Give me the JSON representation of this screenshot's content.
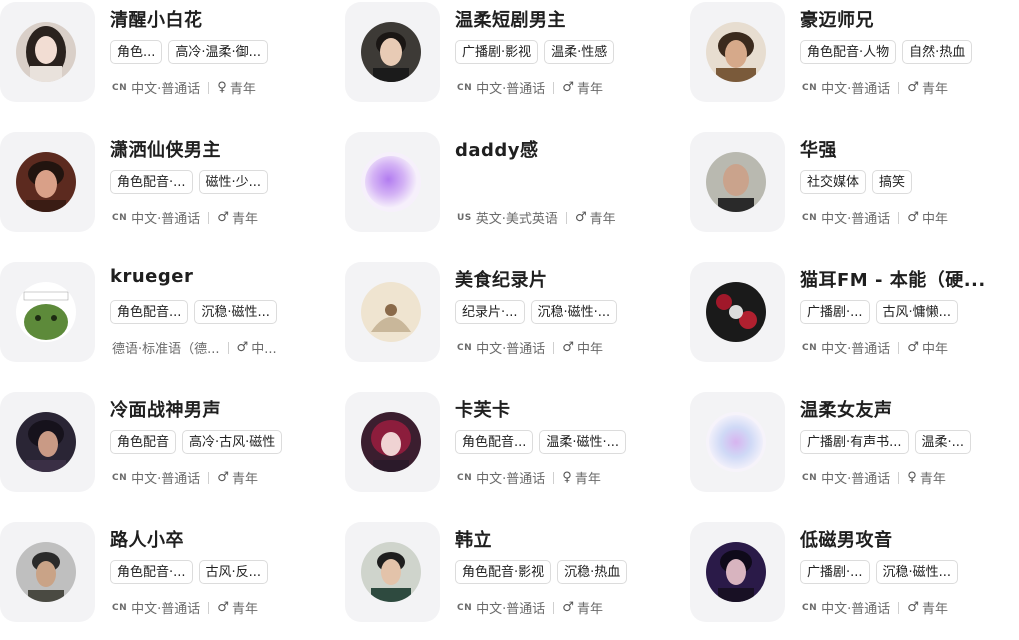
{
  "voices": [
    {
      "name": "清醒小白花",
      "tags": [
        "角色...",
        "高冷·温柔·御..."
      ],
      "country_code": "CN",
      "language": "中文·普通话",
      "gender_icon": "female-icon",
      "gender_symbol": "♀",
      "age": "青年",
      "avatar": "female-portrait"
    },
    {
      "name": "温柔短剧男主",
      "tags": [
        "广播剧·影视",
        "温柔·性感"
      ],
      "country_code": "CN",
      "language": "中文·普通话",
      "gender_icon": "male-icon",
      "gender_symbol": "♂",
      "age": "青年",
      "avatar": "male-portrait"
    },
    {
      "name": "豪迈师兄",
      "tags": [
        "角色配音·人物",
        "自然·热血"
      ],
      "country_code": "CN",
      "language": "中文·普通话",
      "gender_icon": "male-icon",
      "gender_symbol": "♂",
      "age": "青年",
      "avatar": "warrior-portrait"
    },
    {
      "name": "潇洒仙侠男主",
      "tags": [
        "角色配音·...",
        "磁性·少..."
      ],
      "country_code": "CN",
      "language": "中文·普通话",
      "gender_icon": "male-icon",
      "gender_symbol": "♂",
      "age": "青年",
      "avatar": "xianxia-portrait"
    },
    {
      "name": "daddy感",
      "tags": [],
      "country_code": "US",
      "language": "英文·美式英语",
      "gender_icon": "male-icon",
      "gender_symbol": "♂",
      "age": "青年",
      "avatar": "purple-blob"
    },
    {
      "name": "华强",
      "tags": [
        "社交媒体",
        "搞笑"
      ],
      "country_code": "CN",
      "language": "中文·普通话",
      "gender_icon": "male-icon",
      "gender_symbol": "♂",
      "age": "中年",
      "avatar": "man-photo"
    },
    {
      "name": "krueger",
      "tags": [
        "角色配音...",
        "沉稳·磁性..."
      ],
      "country_code": "",
      "language": "德语·标准语（德...",
      "gender_icon": "male-icon",
      "gender_symbol": "♂",
      "age": "中...",
      "avatar": "cartoon-frog"
    },
    {
      "name": "美食纪录片",
      "tags": [
        "纪录片·...",
        "沉稳·磁性·..."
      ],
      "country_code": "CN",
      "language": "中文·普通话",
      "gender_icon": "male-icon",
      "gender_symbol": "♂",
      "age": "中年",
      "avatar": "ink-painting"
    },
    {
      "name": "猫耳FM - 本能（硬...",
      "tags": [
        "广播剧·...",
        "古风·慵懒..."
      ],
      "country_code": "CN",
      "language": "中文·普通话",
      "gender_icon": "male-icon",
      "gender_symbol": "♂",
      "age": "中年",
      "avatar": "dark-roses"
    },
    {
      "name": "冷面战神男声",
      "tags": [
        "角色配音",
        "高冷·古风·磁性"
      ],
      "country_code": "CN",
      "language": "中文·普通话",
      "gender_icon": "male-icon",
      "gender_symbol": "♂",
      "age": "青年",
      "avatar": "dark-warrior"
    },
    {
      "name": "卡芙卡",
      "tags": [
        "角色配音...",
        "温柔·磁性·..."
      ],
      "country_code": "CN",
      "language": "中文·普通话",
      "gender_icon": "female-icon",
      "gender_symbol": "♀",
      "age": "青年",
      "avatar": "anime-girl"
    },
    {
      "name": "温柔女友声",
      "tags": [
        "广播剧·有声书...",
        "温柔·..."
      ],
      "country_code": "CN",
      "language": "中文·普通话",
      "gender_icon": "female-icon",
      "gender_symbol": "♀",
      "age": "青年",
      "avatar": "pastel-blob"
    },
    {
      "name": "路人小卒",
      "tags": [
        "角色配音·...",
        "古风·反..."
      ],
      "country_code": "CN",
      "language": "中文·普通话",
      "gender_icon": "male-icon",
      "gender_symbol": "♂",
      "age": "青年",
      "avatar": "peasant-portrait"
    },
    {
      "name": "韩立",
      "tags": [
        "角色配音·影视",
        "沉稳·热血"
      ],
      "country_code": "CN",
      "language": "中文·普通话",
      "gender_icon": "male-icon",
      "gender_symbol": "♂",
      "age": "青年",
      "avatar": "cultivator-portrait"
    },
    {
      "name": "低磁男攻音",
      "tags": [
        "广播剧·...",
        "沉稳·磁性..."
      ],
      "country_code": "CN",
      "language": "中文·普通话",
      "gender_icon": "male-icon",
      "gender_symbol": "♂",
      "age": "青年",
      "avatar": "purple-man"
    }
  ],
  "colors": {
    "avatar_bg": "#f3f3f5",
    "tag_border": "#dcdcdc",
    "meta_text": "#6b6b6b"
  }
}
